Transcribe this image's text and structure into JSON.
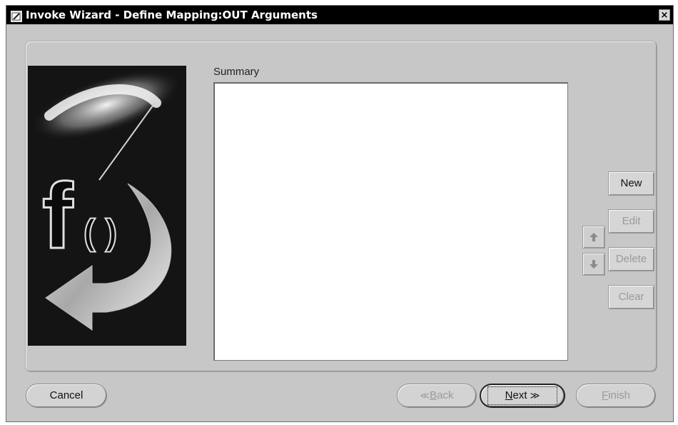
{
  "window": {
    "title": "Invoke Wizard - Define Mapping:OUT Arguments",
    "close_glyph": "×"
  },
  "summary": {
    "label": "Summary"
  },
  "side_buttons": {
    "new": "New",
    "edit": "Edit",
    "delete": "Delete",
    "clear": "Clear"
  },
  "reorder": {
    "up_icon": "arrow-up-icon",
    "down_icon": "arrow-down-icon"
  },
  "footer": {
    "cancel": "Cancel",
    "back_prefix": "≪",
    "back_mnemonic": "B",
    "back_rest": "ack",
    "next_mnemonic": "N",
    "next_rest": "ext",
    "next_suffix": "≫",
    "finish_mnemonic": "F",
    "finish_rest": "inish"
  },
  "colors": {
    "titlebar": "#000000",
    "dialog_bg": "#c7c7c7",
    "disabled_text": "#9a9a9a"
  }
}
